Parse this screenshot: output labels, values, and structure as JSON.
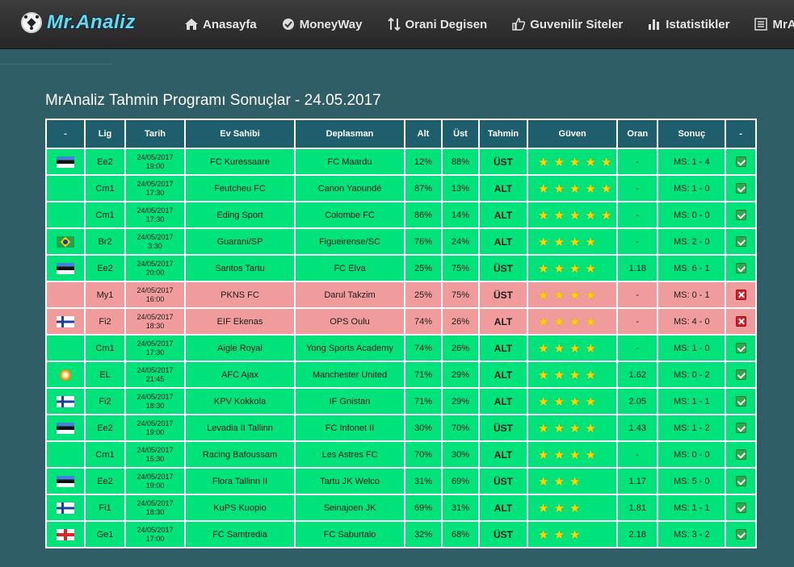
{
  "brand": {
    "name": "Mr.Analiz"
  },
  "nav": [
    {
      "label": "Anasayfa",
      "icon": "home-icon"
    },
    {
      "label": "MoneyWay",
      "icon": "check-circle-icon"
    },
    {
      "label": "Orani Degisen",
      "icon": "sort-arrows-icon"
    },
    {
      "label": "Guvenilir Siteler",
      "icon": "thumbs-up-icon"
    },
    {
      "label": "Istatistikler",
      "icon": "bar-chart-icon"
    },
    {
      "label": "MrAnaliz-S",
      "icon": "document-list-icon"
    }
  ],
  "page": {
    "title": "MrAnaliz Tahmin Programı Sonuçlar - 24.05.2017"
  },
  "table": {
    "headers": [
      "-",
      "Lig",
      "Tarih",
      "Ev Sahibi",
      "Deplasman",
      "Alt",
      "Üst",
      "Tahmin",
      "Güven",
      "Oran",
      "Sonuç",
      "-"
    ],
    "rows": [
      {
        "flag": "estonia-flag",
        "league": "Ee2",
        "date": "24/05/2017",
        "time": "19:00",
        "home": "FC Kuressaare",
        "away": "FC Maardu",
        "alt": "12%",
        "ust": "88%",
        "pick": "ÜST",
        "stars": 5,
        "odds": "-",
        "result": "MS: 1 - 4",
        "status": "won"
      },
      {
        "flag": "",
        "league": "Cm1",
        "date": "24/05/2017",
        "time": "17:30",
        "home": "Feutcheu FC",
        "away": "Canon Yaoundé",
        "alt": "87%",
        "ust": "13%",
        "pick": "ALT",
        "stars": 5,
        "odds": "-",
        "result": "MS: 1 - 0",
        "status": "won"
      },
      {
        "flag": "",
        "league": "Cm1",
        "date": "24/05/2017",
        "time": "17:30",
        "home": "Eding Sport",
        "away": "Colombe FC",
        "alt": "86%",
        "ust": "14%",
        "pick": "ALT",
        "stars": 5,
        "odds": "-",
        "result": "MS: 0 - 0",
        "status": "won"
      },
      {
        "flag": "brazil-flag",
        "league": "Br2",
        "date": "24/05/2017",
        "time": "3:30",
        "home": "Guarani/SP",
        "away": "Figueirense/SC",
        "alt": "76%",
        "ust": "24%",
        "pick": "ALT",
        "stars": 4,
        "odds": "-",
        "result": "MS: 2 - 0",
        "status": "won"
      },
      {
        "flag": "estonia-flag",
        "league": "Ee2",
        "date": "24/05/2017",
        "time": "20:00",
        "home": "Santos Tartu",
        "away": "FC Elva",
        "alt": "25%",
        "ust": "75%",
        "pick": "ÜST",
        "stars": 4,
        "odds": "1.18",
        "result": "MS: 6 - 1",
        "status": "won"
      },
      {
        "flag": "",
        "league": "My1",
        "date": "24/05/2017",
        "time": "16:00",
        "home": "PKNS FC",
        "away": "Darul Takzim",
        "alt": "25%",
        "ust": "75%",
        "pick": "ÜST",
        "stars": 4,
        "odds": "-",
        "result": "MS: 0 - 1",
        "status": "lost"
      },
      {
        "flag": "finland-flag",
        "league": "Fi2",
        "date": "24/05/2017",
        "time": "18:30",
        "home": "EIF Ekenas",
        "away": "OPS Oulu",
        "alt": "74%",
        "ust": "26%",
        "pick": "ALT",
        "stars": 4,
        "odds": "-",
        "result": "MS: 4 - 0",
        "status": "lost"
      },
      {
        "flag": "",
        "league": "Cm1",
        "date": "24/05/2017",
        "time": "17:30",
        "home": "Aigle Royal",
        "away": "Yong Sports Academy",
        "alt": "74%",
        "ust": "26%",
        "pick": "ALT",
        "stars": 4,
        "odds": "-",
        "result": "MS: 1 - 0",
        "status": "won"
      },
      {
        "flag": "europa-league-icon",
        "league": "EL",
        "date": "24/05/2017",
        "time": "21:45",
        "home": "AFC Ajax",
        "away": "Manchester United",
        "alt": "71%",
        "ust": "29%",
        "pick": "ALT",
        "stars": 4,
        "odds": "1.62",
        "result": "MS: 0 - 2",
        "status": "won"
      },
      {
        "flag": "finland-flag",
        "league": "Fi2",
        "date": "24/05/2017",
        "time": "18:30",
        "home": "KPV Kokkola",
        "away": "IF Gnistan",
        "alt": "71%",
        "ust": "29%",
        "pick": "ALT",
        "stars": 4,
        "odds": "2.05",
        "result": "MS: 1 - 1",
        "status": "won"
      },
      {
        "flag": "estonia-flag",
        "league": "Ee2",
        "date": "24/05/2017",
        "time": "19:00",
        "home": "Levadia II Tallinn",
        "away": "FC Infonet II",
        "alt": "30%",
        "ust": "70%",
        "pick": "ÜST",
        "stars": 4,
        "odds": "1.43",
        "result": "MS: 1 - 2",
        "status": "won"
      },
      {
        "flag": "",
        "league": "Cm1",
        "date": "24/05/2017",
        "time": "15:30",
        "home": "Racing Bafoussam",
        "away": "Les Astres FC",
        "alt": "70%",
        "ust": "30%",
        "pick": "ALT",
        "stars": 4,
        "odds": "-",
        "result": "MS: 0 - 0",
        "status": "won"
      },
      {
        "flag": "estonia-flag",
        "league": "Ee2",
        "date": "24/05/2017",
        "time": "19:00",
        "home": "Flora Tallinn II",
        "away": "Tartu JK Welco",
        "alt": "31%",
        "ust": "69%",
        "pick": "ÜST",
        "stars": 3,
        "odds": "1.17",
        "result": "MS: 5 - 0",
        "status": "won"
      },
      {
        "flag": "finland-flag",
        "league": "Fi1",
        "date": "24/05/2017",
        "time": "18:30",
        "home": "KuPS Kuopio",
        "away": "Seinajoen JK",
        "alt": "69%",
        "ust": "31%",
        "pick": "ALT",
        "stars": 3,
        "odds": "1.81",
        "result": "MS: 1 - 1",
        "status": "won"
      },
      {
        "flag": "georgia-flag",
        "league": "Ge1",
        "date": "24/05/2017",
        "time": "17:00",
        "home": "FC Samtredia",
        "away": "FC Saburtalo",
        "alt": "32%",
        "ust": "68%",
        "pick": "ÜST",
        "stars": 3,
        "odds": "2.18",
        "result": "MS: 3 - 2",
        "status": "won"
      }
    ]
  }
}
